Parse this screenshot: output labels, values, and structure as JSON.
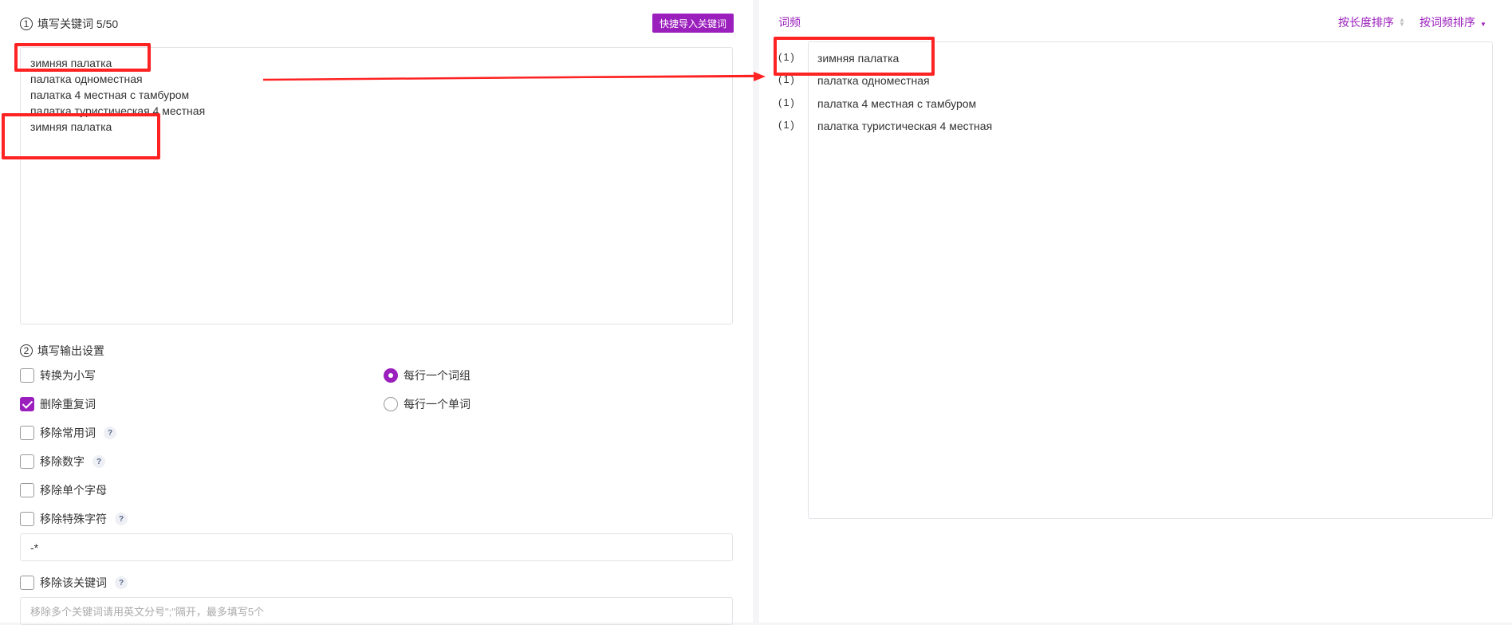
{
  "step1": {
    "num": "1",
    "title": "填写关键词 5/50",
    "import_label": "快捷导入关键词"
  },
  "keywords": [
    "зимняя палатка",
    "палатка одноместная",
    "палатка 4 местная с тамбуром",
    "палатка туристическая 4 местная",
    "зимняя палатка"
  ],
  "step2": {
    "num": "2",
    "title": "填写输出设置"
  },
  "options": {
    "lowercase": {
      "label": "转换为小写",
      "checked": false
    },
    "dedupe": {
      "label": "删除重复词",
      "checked": true
    },
    "remove_common": {
      "label": "移除常用词",
      "checked": false
    },
    "remove_numbers": {
      "label": "移除数字",
      "checked": false
    },
    "remove_single": {
      "label": "移除单个字母",
      "checked": false
    },
    "remove_special": {
      "label": "移除特殊字符",
      "checked": false
    },
    "remove_keyword": {
      "label": "移除该关键词",
      "checked": false
    },
    "per_phrase": {
      "label": "每行一个词组",
      "checked": true
    },
    "per_word": {
      "label": "每行一个单词",
      "checked": false
    }
  },
  "help_mark": "?",
  "special_chars_value": "-*",
  "remove_keyword_placeholder": "移除多个关键词请用英文分号\";\"隔开，最多填写5个",
  "freq": {
    "title": "词频",
    "sort_length": "按长度排序",
    "sort_freq": "按词频排序",
    "counts": [
      "(1)",
      "(1)",
      "(1)",
      "(1)"
    ],
    "words": [
      "зимняя палатка",
      "палатка одноместная",
      "палатка 4 местная с тамбуром",
      "палатка туристическая 4 местная"
    ]
  },
  "colors": {
    "accent": "#9b1fbd",
    "annotation": "#ff2222"
  }
}
